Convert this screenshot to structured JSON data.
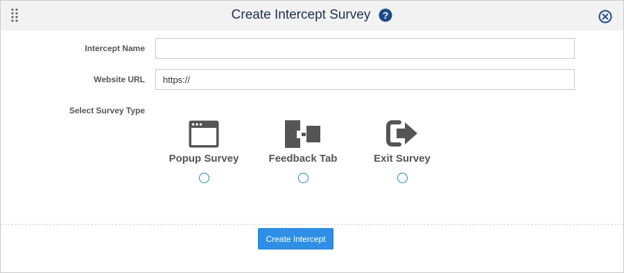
{
  "dialog": {
    "title": "Create Intercept Survey",
    "icons": {
      "drag": "drag-handle-icon",
      "help": "help-icon",
      "close": "close-icon"
    }
  },
  "form": {
    "intercept_name": {
      "label": "Intercept Name",
      "value": "",
      "placeholder": ""
    },
    "website_url": {
      "label": "Website URL",
      "value": "https://",
      "placeholder": ""
    },
    "survey_type": {
      "label": "Select Survey Type",
      "options": [
        {
          "label": "Popup Survey",
          "icon": "browser-window-icon",
          "selected": false
        },
        {
          "label": "Feedback Tab",
          "icon": "feedback-tab-icon",
          "selected": false
        },
        {
          "label": "Exit Survey",
          "icon": "exit-arrow-icon",
          "selected": false
        }
      ]
    }
  },
  "footer": {
    "create_label": "Create Intercept"
  },
  "colors": {
    "header_bg": "#f2f2f2",
    "title": "#1f2f4f",
    "accent": "#2f8fe6",
    "radio": "#1d8aa0",
    "icon_gray": "#555555",
    "help_navy": "#1a4a8a"
  }
}
